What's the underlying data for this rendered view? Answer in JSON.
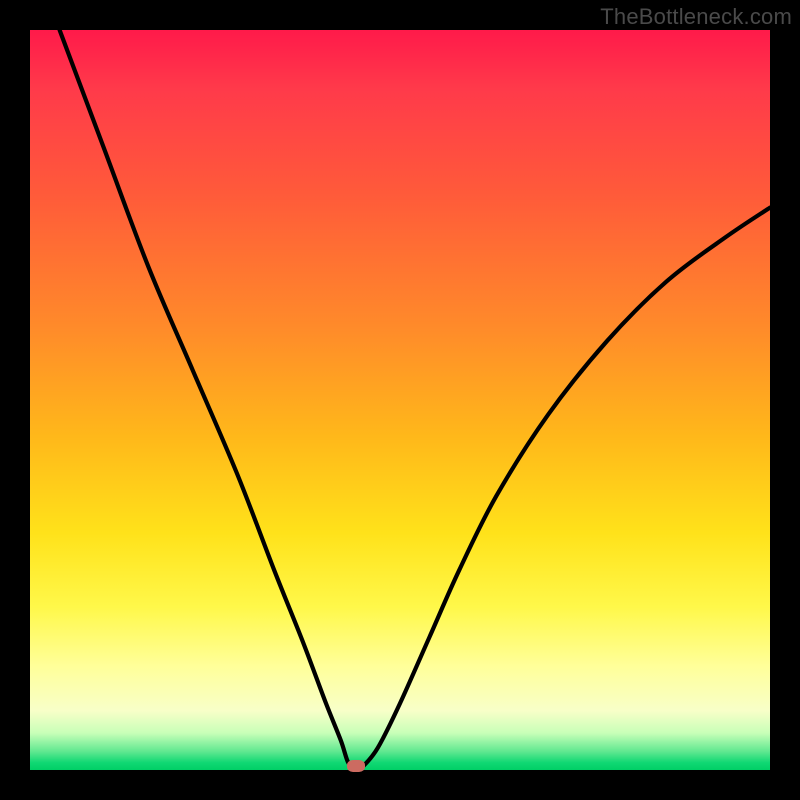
{
  "watermark": "TheBottleneck.com",
  "colors": {
    "frame_bg": "#000000",
    "curve": "#000000",
    "marker": "#cc6b61",
    "gradient_top": "#ff1a4a",
    "gradient_bottom": "#00cf66"
  },
  "chart_data": {
    "type": "line",
    "title": "",
    "xlabel": "",
    "ylabel": "",
    "xlim": [
      0,
      100
    ],
    "ylim": [
      0,
      100
    ],
    "grid": false,
    "legend": false,
    "series": [
      {
        "name": "bottleneck-curve",
        "x": [
          4,
          10,
          16,
          22,
          28,
          33,
          37,
          40,
          42,
          43,
          44,
          45,
          47,
          50,
          54,
          58,
          63,
          70,
          78,
          86,
          94,
          100
        ],
        "y": [
          100,
          84,
          68,
          54,
          40,
          27,
          17,
          9,
          4,
          1,
          0,
          0.5,
          3,
          9,
          18,
          27,
          37,
          48,
          58,
          66,
          72,
          76
        ]
      }
    ],
    "marker": {
      "x": 44,
      "y": 0.5
    }
  }
}
